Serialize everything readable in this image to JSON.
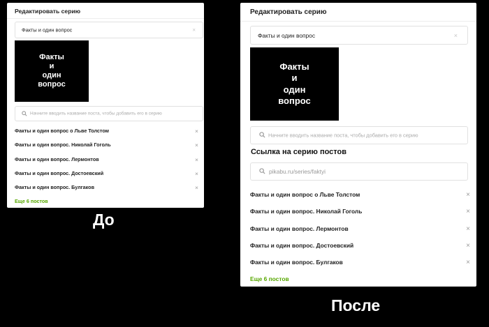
{
  "before": {
    "title": "Редактировать серию",
    "series_name_value": "Факты и один вопрос",
    "clear_glyph": "×",
    "cover_lines": [
      "Факты",
      "и",
      "один",
      "вопрос"
    ],
    "search_placeholder": "Начните вводить название поста, чтобы добавить его в серию",
    "posts": [
      "Факты и один вопрос о Льве Толстом",
      "Факты и один вопрос. Николай Гоголь",
      "Факты и один вопрос. Лермонтов",
      "Факты и один вопрос. Достоевский",
      "Факты и один вопрос. Булгаков"
    ],
    "remove_glyph": "×",
    "more_link": "Еще 6 постов",
    "caption": "До"
  },
  "after": {
    "title": "Редактировать серию",
    "series_name_value": "Факты и один вопрос",
    "clear_glyph": "×",
    "cover_lines": [
      "Факты",
      "и",
      "один",
      "вопрос"
    ],
    "search_placeholder": "Начните вводить название поста, чтобы добавить его в серию",
    "link_heading": "Ссылка на серию постов",
    "link_value": "pikabu.ru/series/faktyi",
    "posts": [
      "Факты и один вопрос о Льве Толстом",
      "Факты и один вопрос. Николай Гоголь",
      "Факты и один вопрос. Лермонтов",
      "Факты и один вопрос. Достоевский",
      "Факты и один вопрос. Булгаков"
    ],
    "remove_glyph": "×",
    "more_link": "Еще 6 постов",
    "caption": "После"
  },
  "icons": {
    "search": "search-icon",
    "clear": "close-icon",
    "remove": "close-icon"
  },
  "colors": {
    "background": "#000000",
    "panel": "#ffffff",
    "accent_link": "#57a700",
    "cover": "#000000"
  }
}
